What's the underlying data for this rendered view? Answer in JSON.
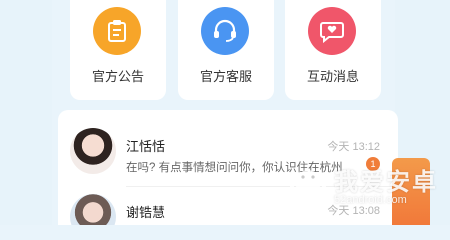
{
  "cards": [
    {
      "label": "官方公告",
      "icon": "clipboard-icon",
      "color": "#f7a529"
    },
    {
      "label": "官方客服",
      "icon": "headset-icon",
      "color": "#4a95f2"
    },
    {
      "label": "互动消息",
      "icon": "chat-heart-icon",
      "color": "#f0566a"
    }
  ],
  "messages": [
    {
      "name": "江恬恬",
      "preview": "在吗? 有点事情想问问你，你认识住在杭州",
      "time": "今天 13:12",
      "unread": "1"
    },
    {
      "name": "谢锆慧",
      "preview": "",
      "time": "今天 13:08",
      "unread": ""
    }
  ],
  "watermark": {
    "text": "我爱安卓",
    "url": "52android.com"
  }
}
